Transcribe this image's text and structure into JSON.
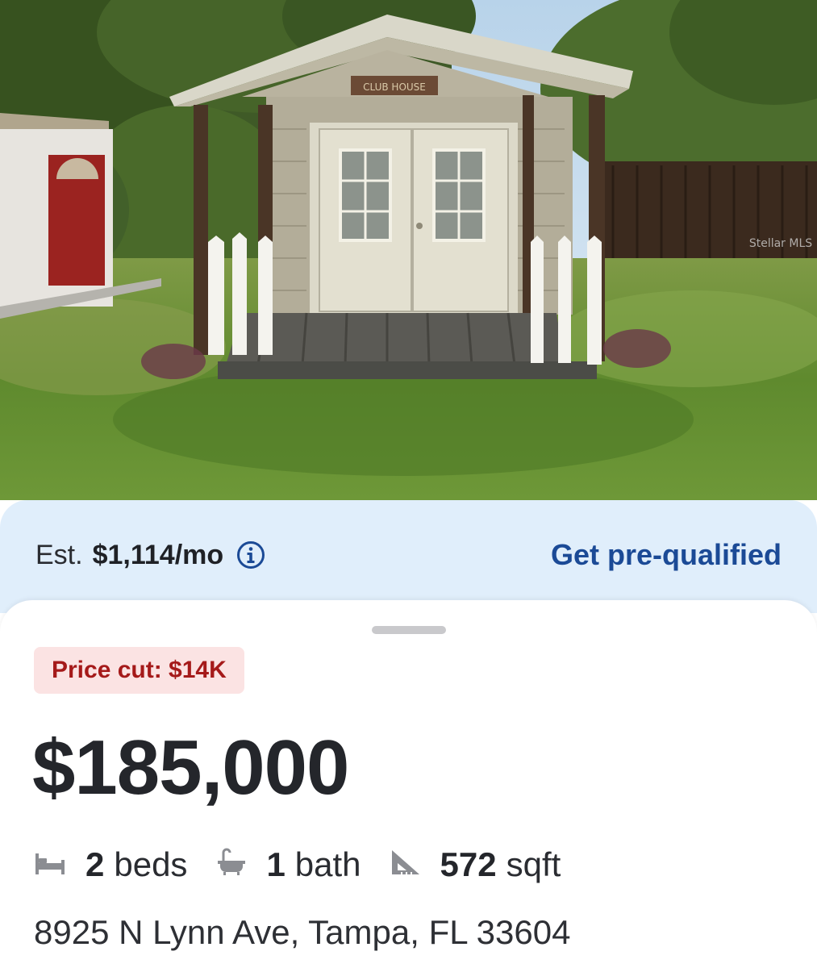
{
  "photo": {
    "sign_text": "CLUB HOUSE",
    "watermark": "Stellar MLS"
  },
  "mortgage": {
    "est_label": "Est.",
    "est_value": "$1,114/mo",
    "info_icon": "info-circle-icon",
    "prequal_label": "Get pre-qualified",
    "accent_color": "#1b4a96"
  },
  "listing": {
    "price_cut": "Price cut: $14K",
    "price": "$185,000",
    "beds_count": "2",
    "beds_unit": "beds",
    "baths_count": "1",
    "baths_unit": "bath",
    "sqft_count": "572",
    "sqft_unit": "sqft",
    "address": "8925 N Lynn Ave, Tampa, FL 33604",
    "icons": [
      "bed-icon",
      "bathtub-icon",
      "ruler-triangle-icon"
    ]
  }
}
